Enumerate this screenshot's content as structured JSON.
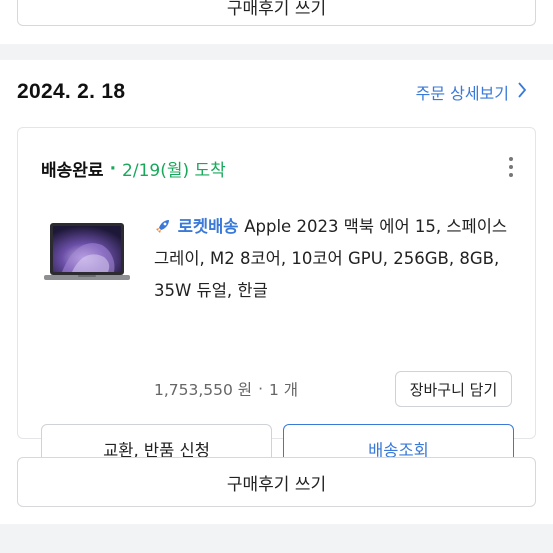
{
  "previous_order": {
    "review_button": "구매후기 쓰기"
  },
  "order": {
    "date": "2024. 2. 18",
    "detail_link": "주문 상세보기",
    "shipment": {
      "status": "배송완료",
      "separator": "·",
      "arrival": "2/19(월) 도착",
      "product": {
        "delivery_badge": "로켓배송",
        "name": "Apple 2023 맥북 에어 15, 스페이스 그레이, M2 8코어, 10코어 GPU, 256GB, 8GB, 35W 듀얼, 한글",
        "price": "1,753,550 원",
        "separator": "·",
        "quantity": "1 개"
      },
      "cart_button": "장바구니 담기",
      "exchange_button": "교환, 반품 신청",
      "track_button": "배송조회"
    },
    "review_button": "구매후기 쓰기"
  },
  "colors": {
    "accent": "#3a79d8",
    "status_green": "#19a85b"
  },
  "icons": [
    "chevron-right-icon",
    "kebab-menu-icon",
    "rocket-icon"
  ]
}
